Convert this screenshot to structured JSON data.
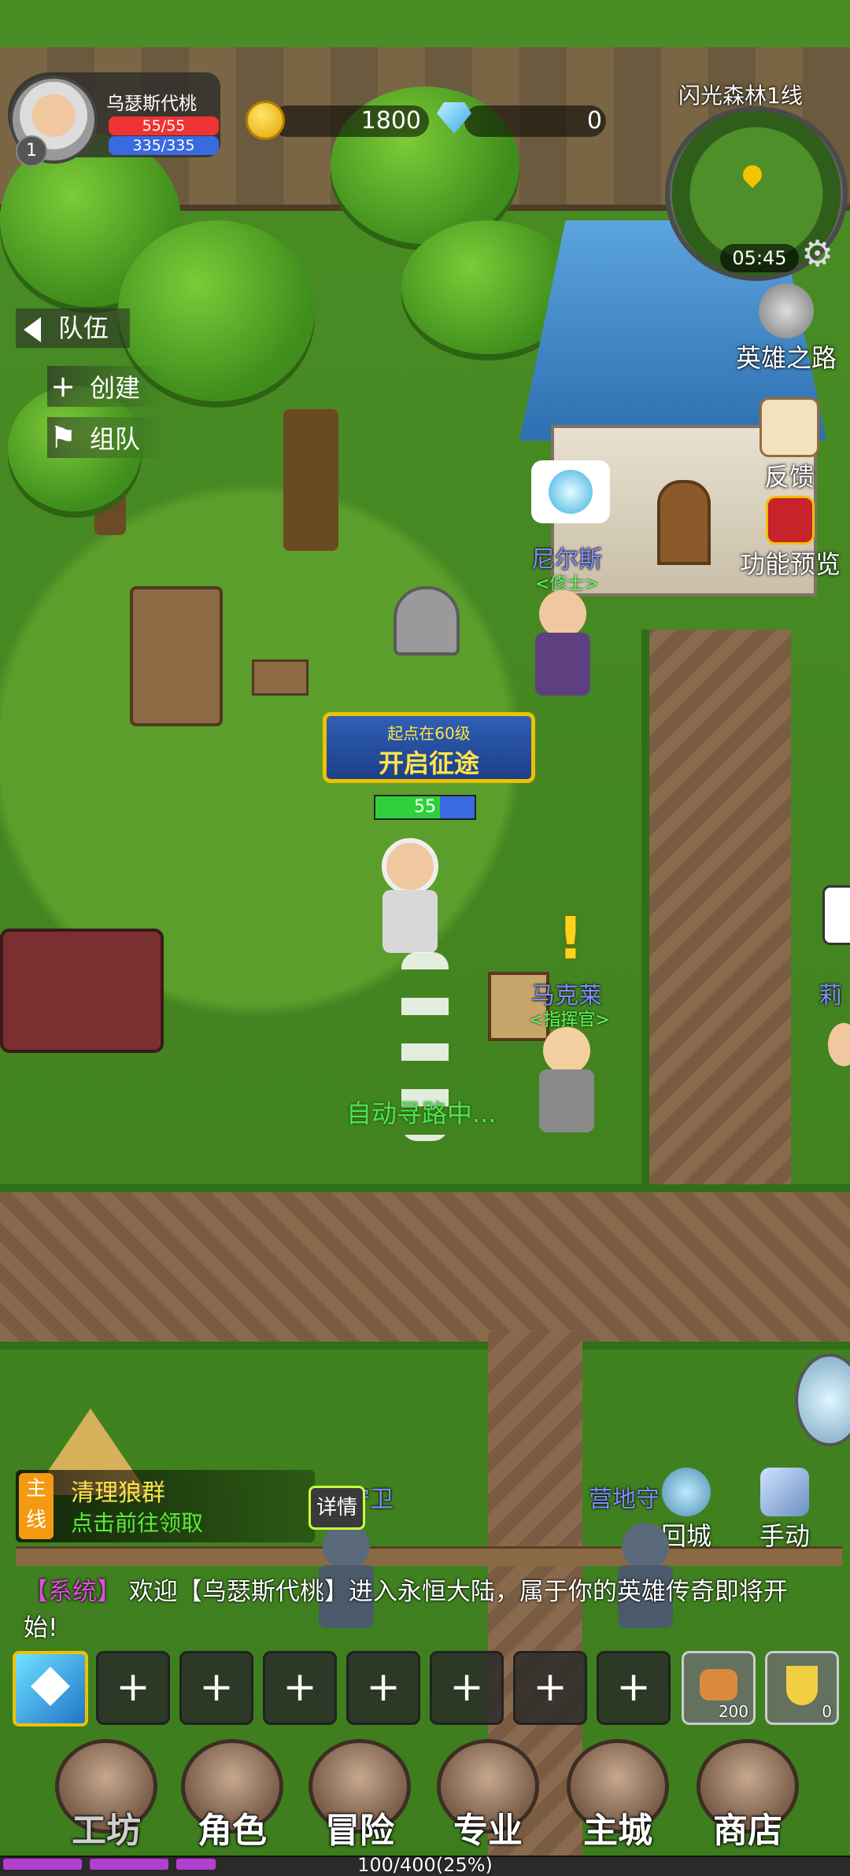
{
  "player": {
    "name": "乌瑟斯代桃",
    "level": "1",
    "hp": "55/55",
    "mp": "335/335",
    "overhead_hp": "55"
  },
  "currency": {
    "gold": "1800",
    "gems": "0"
  },
  "map": {
    "name": "闪光森林1线",
    "time": "05:45"
  },
  "right_menu": [
    {
      "label": "英雄之路",
      "icon": "helmet-icon"
    },
    {
      "label": "反馈",
      "icon": "feedback-icon"
    },
    {
      "label": "功能预览",
      "icon": "preview-icon"
    },
    {
      "label": "回城",
      "icon": "return-town-icon"
    },
    {
      "label": "手动",
      "icon": "manual-icon"
    }
  ],
  "team": {
    "title": "队伍",
    "create": "创建",
    "party": "组队"
  },
  "npcs": [
    {
      "name": "尼尔斯",
      "title": "<修士>"
    },
    {
      "name": "马克莱",
      "title": "<指挥官>"
    },
    {
      "name": "莉"
    },
    {
      "name": "守卫"
    },
    {
      "name": "营地守"
    }
  ],
  "banner": {
    "line1": "起点在60级",
    "line2": "开启征途"
  },
  "status": {
    "autopath": "自动寻路中..."
  },
  "quest": {
    "tag": "主线",
    "title": "清理狼群",
    "subtitle": "点击前往领取",
    "detail_button": "详情"
  },
  "chat": {
    "tag": "【系统】",
    "message": "欢迎【乌瑟斯代桃】进入永恒大陆，属于你的英雄传奇即将开始!"
  },
  "skillbar": {
    "empty_slot": "+",
    "items": [
      {
        "count": "200"
      },
      {
        "count": "0"
      }
    ]
  },
  "nav": [
    "工坊",
    "角色",
    "冒险",
    "专业",
    "主城",
    "商店"
  ],
  "experience": {
    "text": "100/400(25%)",
    "percent": 25
  },
  "colors": {
    "hp": "#e33333",
    "mp": "#3a6ae0",
    "quest_title": "#ffe24a",
    "npc_name": "#7f8cff",
    "chat_tag": "#e24ce0",
    "exp": "#b33fd0"
  }
}
